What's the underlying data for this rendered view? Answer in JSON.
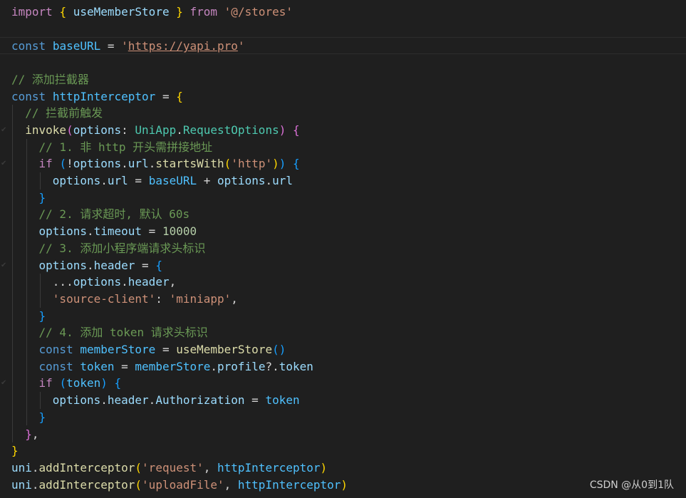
{
  "editor": {
    "colors": {
      "background": "#1f1f1f",
      "keyword": "#569cd6",
      "control_keyword": "#c586c0",
      "variable": "#9cdcfe",
      "constant": "#4fc1ff",
      "function": "#dcdcaa",
      "type": "#4ec9b0",
      "string": "#ce9178",
      "comment": "#6a9955",
      "number": "#b5cea8",
      "bracket_level1": "#ffd700",
      "bracket_level2": "#da70d6",
      "bracket_level3": "#179fff"
    },
    "lines": [
      [
        [
          "kw2",
          "import"
        ],
        [
          "op",
          " "
        ],
        [
          "b1",
          "{"
        ],
        [
          "op",
          " "
        ],
        [
          "vr",
          "useMemberStore"
        ],
        [
          "op",
          " "
        ],
        [
          "b1",
          "}"
        ],
        [
          "op",
          " "
        ],
        [
          "kw2",
          "from"
        ],
        [
          "op",
          " "
        ],
        [
          "st",
          "'@/stores'"
        ]
      ],
      [],
      [
        [
          "kw",
          "const"
        ],
        [
          "op",
          " "
        ],
        [
          "cn",
          "baseURL"
        ],
        [
          "op",
          " = "
        ],
        [
          "st",
          "'"
        ],
        [
          "st url",
          "https://yapi.pro"
        ],
        [
          "st",
          "'"
        ]
      ],
      [],
      [
        [
          "cm",
          "// 添加拦截器"
        ]
      ],
      [
        [
          "kw",
          "const"
        ],
        [
          "op",
          " "
        ],
        [
          "cn",
          "httpInterceptor"
        ],
        [
          "op",
          " = "
        ],
        [
          "b1",
          "{"
        ]
      ],
      [
        [
          "op",
          "  "
        ],
        [
          "cm",
          "// 拦截前触发"
        ]
      ],
      [
        [
          "op",
          "  "
        ],
        [
          "fn",
          "invoke"
        ],
        [
          "b2",
          "("
        ],
        [
          "vr",
          "options"
        ],
        [
          "op",
          ": "
        ],
        [
          "ty",
          "UniApp"
        ],
        [
          "op",
          "."
        ],
        [
          "ty",
          "RequestOptions"
        ],
        [
          "b2",
          ")"
        ],
        [
          "op",
          " "
        ],
        [
          "b2",
          "{"
        ]
      ],
      [
        [
          "op",
          "    "
        ],
        [
          "cm",
          "// 1. 非 http 开头需拼接地址"
        ]
      ],
      [
        [
          "op",
          "    "
        ],
        [
          "kw2",
          "if"
        ],
        [
          "op",
          " "
        ],
        [
          "b3",
          "("
        ],
        [
          "op",
          "!"
        ],
        [
          "vr",
          "options"
        ],
        [
          "op",
          "."
        ],
        [
          "vr",
          "url"
        ],
        [
          "op",
          "."
        ],
        [
          "fn",
          "startsWith"
        ],
        [
          "b1",
          "("
        ],
        [
          "st",
          "'http'"
        ],
        [
          "b1",
          ")"
        ],
        [
          "b3",
          ")"
        ],
        [
          "op",
          " "
        ],
        [
          "b3",
          "{"
        ]
      ],
      [
        [
          "op",
          "      "
        ],
        [
          "vr",
          "options"
        ],
        [
          "op",
          "."
        ],
        [
          "vr",
          "url"
        ],
        [
          "op",
          " = "
        ],
        [
          "cn",
          "baseURL"
        ],
        [
          "op",
          " + "
        ],
        [
          "vr",
          "options"
        ],
        [
          "op",
          "."
        ],
        [
          "vr",
          "url"
        ]
      ],
      [
        [
          "op",
          "    "
        ],
        [
          "b3",
          "}"
        ]
      ],
      [
        [
          "op",
          "    "
        ],
        [
          "cm",
          "// 2. 请求超时, 默认 60s"
        ]
      ],
      [
        [
          "op",
          "    "
        ],
        [
          "vr",
          "options"
        ],
        [
          "op",
          "."
        ],
        [
          "vr",
          "timeout"
        ],
        [
          "op",
          " = "
        ],
        [
          "nu",
          "10000"
        ]
      ],
      [
        [
          "op",
          "    "
        ],
        [
          "cm",
          "// 3. 添加小程序端请求头标识"
        ]
      ],
      [
        [
          "op",
          "    "
        ],
        [
          "vr",
          "options"
        ],
        [
          "op",
          "."
        ],
        [
          "vr",
          "header"
        ],
        [
          "op",
          " = "
        ],
        [
          "b3",
          "{"
        ]
      ],
      [
        [
          "op",
          "      ..."
        ],
        [
          "vr",
          "options"
        ],
        [
          "op",
          "."
        ],
        [
          "vr",
          "header"
        ],
        [
          "op",
          ","
        ]
      ],
      [
        [
          "op",
          "      "
        ],
        [
          "st",
          "'source-client'"
        ],
        [
          "op",
          ": "
        ],
        [
          "st",
          "'miniapp'"
        ],
        [
          "op",
          ","
        ]
      ],
      [
        [
          "op",
          "    "
        ],
        [
          "b3",
          "}"
        ]
      ],
      [
        [
          "op",
          "    "
        ],
        [
          "cm",
          "// 4. 添加 token 请求头标识"
        ]
      ],
      [
        [
          "op",
          "    "
        ],
        [
          "kw",
          "const"
        ],
        [
          "op",
          " "
        ],
        [
          "cn",
          "memberStore"
        ],
        [
          "op",
          " = "
        ],
        [
          "fn",
          "useMemberStore"
        ],
        [
          "b3",
          "("
        ],
        [
          "b3",
          ")"
        ]
      ],
      [
        [
          "op",
          "    "
        ],
        [
          "kw",
          "const"
        ],
        [
          "op",
          " "
        ],
        [
          "cn",
          "token"
        ],
        [
          "op",
          " = "
        ],
        [
          "cn",
          "memberStore"
        ],
        [
          "op",
          "."
        ],
        [
          "vr",
          "profile"
        ],
        [
          "op",
          "?."
        ],
        [
          "vr",
          "token"
        ]
      ],
      [
        [
          "op",
          "    "
        ],
        [
          "kw2",
          "if"
        ],
        [
          "op",
          " "
        ],
        [
          "b3",
          "("
        ],
        [
          "cn",
          "token"
        ],
        [
          "b3",
          ")"
        ],
        [
          "op",
          " "
        ],
        [
          "b3",
          "{"
        ]
      ],
      [
        [
          "op",
          "      "
        ],
        [
          "vr",
          "options"
        ],
        [
          "op",
          "."
        ],
        [
          "vr",
          "header"
        ],
        [
          "op",
          "."
        ],
        [
          "vr",
          "Authorization"
        ],
        [
          "op",
          " = "
        ],
        [
          "cn",
          "token"
        ]
      ],
      [
        [
          "op",
          "    "
        ],
        [
          "b3",
          "}"
        ]
      ],
      [
        [
          "op",
          "  "
        ],
        [
          "b2",
          "}"
        ],
        [
          "op",
          ","
        ]
      ],
      [
        [
          "b1",
          "}"
        ]
      ],
      [
        [
          "vr",
          "uni"
        ],
        [
          "op",
          "."
        ],
        [
          "fn",
          "addInterceptor"
        ],
        [
          "b1",
          "("
        ],
        [
          "st",
          "'request'"
        ],
        [
          "op",
          ", "
        ],
        [
          "cn",
          "httpInterceptor"
        ],
        [
          "b1",
          ")"
        ]
      ],
      [
        [
          "vr",
          "uni"
        ],
        [
          "op",
          "."
        ],
        [
          "fn",
          "addInterceptor"
        ],
        [
          "b1",
          "("
        ],
        [
          "st",
          "'uploadFile'"
        ],
        [
          "op",
          ", "
        ],
        [
          "cn",
          "httpInterceptor"
        ],
        [
          "b1",
          ")"
        ]
      ]
    ]
  },
  "watermark": {
    "text": "CSDN @从0到1队"
  }
}
